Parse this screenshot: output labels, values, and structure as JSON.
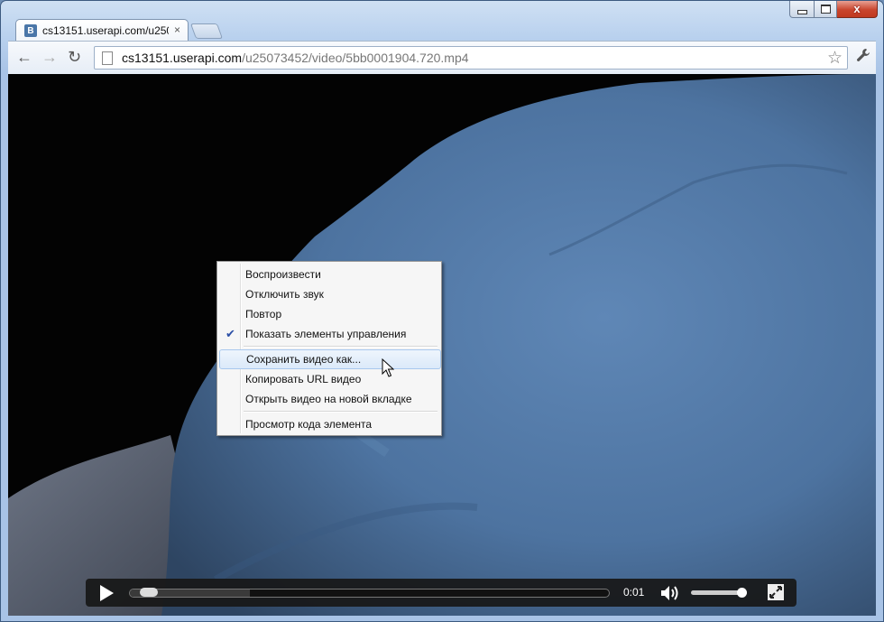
{
  "browser": {
    "tab": {
      "favicon_letter": "В",
      "title": "cs13151.userapi.com/u250",
      "close": "×"
    },
    "nav": {
      "back": "←",
      "forward": "→",
      "reload": "↻"
    },
    "address": {
      "host": "cs13151.userapi.com",
      "path": "/u25073452/video/5bb0001904.720.mp4"
    },
    "star": "☆",
    "wrench": "🔧",
    "window_controls": {
      "close": "x"
    }
  },
  "context_menu": {
    "items": [
      {
        "label": "Воспроизвести"
      },
      {
        "label": "Отключить звук"
      },
      {
        "label": "Повтор"
      },
      {
        "label": "Показать элементы управления",
        "checked": true
      },
      {
        "label": "Сохранить видео как...",
        "highlighted": true
      },
      {
        "label": "Копировать URL видео"
      },
      {
        "label": "Открыть видео на новой вкладке"
      },
      {
        "label": "Просмотр кода элемента"
      }
    ],
    "check_mark": "✔"
  },
  "video_controls": {
    "time": "0:01",
    "progress_fraction": 0.02,
    "buffered_fraction": 0.25,
    "volume_fraction": 1.0
  },
  "colors": {
    "highlight": "#dbe9f9",
    "check": "#2b4fa6",
    "control_bar": "#181818"
  },
  "icons": [
    "play-icon",
    "volume-icon",
    "fullscreen-icon",
    "star-icon",
    "wrench-icon",
    "page-icon"
  ]
}
